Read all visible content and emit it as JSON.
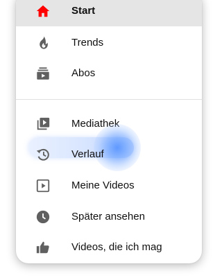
{
  "menu": {
    "items": [
      {
        "label": "Start",
        "icon": "home-icon",
        "active": true
      },
      {
        "label": "Trends",
        "icon": "flame-icon"
      },
      {
        "label": "Abos",
        "icon": "subscriptions-icon"
      },
      {
        "label": "Mediathek",
        "icon": "library-icon"
      },
      {
        "label": "Verlauf",
        "icon": "history-icon",
        "highlighted": true
      },
      {
        "label": "Meine Videos",
        "icon": "my-videos-icon"
      },
      {
        "label": "Später ansehen",
        "icon": "clock-icon"
      },
      {
        "label": "Videos, die ich mag",
        "icon": "thumbs-up-icon"
      }
    ]
  },
  "colors": {
    "accent_home": "#ff0000",
    "icon": "#606060",
    "text": "#0f0f0f",
    "active_bg": "#e5e5e5",
    "highlight": "#6ea0ff"
  }
}
